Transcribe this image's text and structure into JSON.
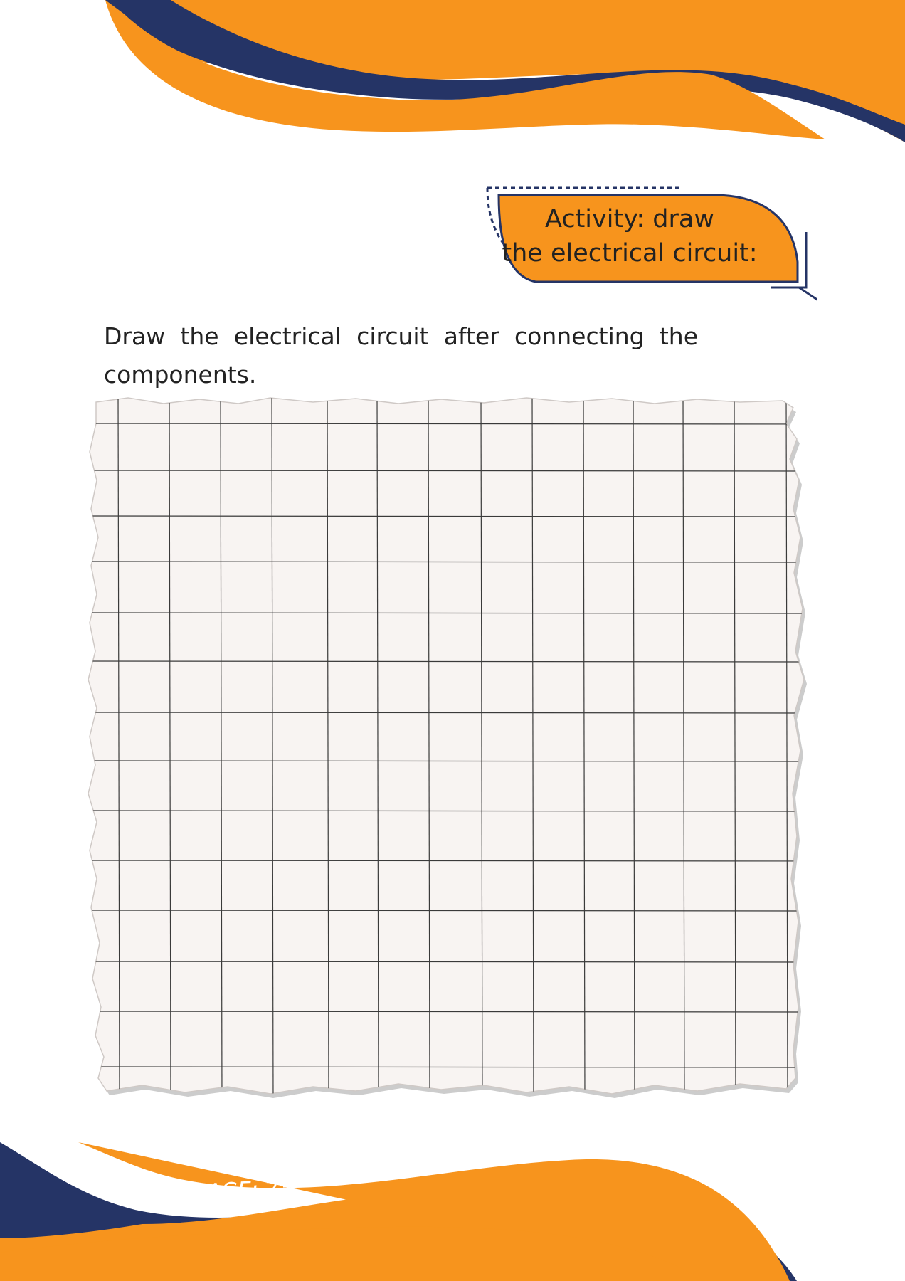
{
  "activity": {
    "title_line1": "Activity: draw",
    "title_line2": "the electrical circuit:"
  },
  "instruction": "Draw the electrical circuit after connecting the components.",
  "footer": {
    "page_label": "PAGE:",
    "page_number": "23"
  },
  "colors": {
    "orange": "#F7941D",
    "navy": "#253466",
    "paper": "#F8F4F2",
    "grid_line": "#3a3a3a"
  },
  "icons": [
    "wave-header-decoration",
    "wave-footer-decoration",
    "dotted-frame-decoration",
    "connector-circle-icon"
  ]
}
